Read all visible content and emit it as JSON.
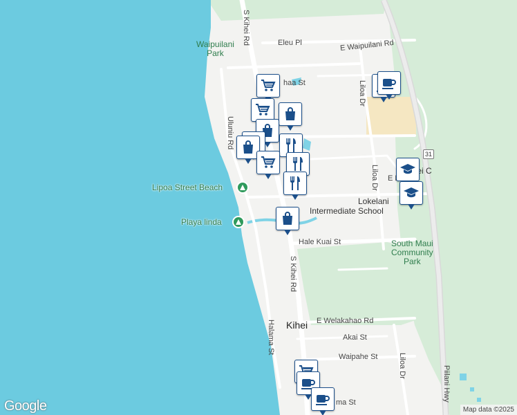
{
  "colors": {
    "ocean": "#6ccbe0",
    "land": "#f3f3f1",
    "park": "#d6ecd8",
    "commercial": "#f5e7c2",
    "road": "#ffffff",
    "highway": "#e3e3e3",
    "marker_border": "#1b4f8a"
  },
  "parks": {
    "waipuilani": "Waipuilani\nPark",
    "south_maui": "South Maui\nCommunity\nPark",
    "kihei_c": "Kihei C"
  },
  "streets": {
    "s_kihei_rd_north": "S Kihei Rd",
    "s_kihei_rd_south": "S Kihei Rd",
    "eleu_pl": "Eleu Pl",
    "e_waipuilani_rd": "E Waipuilani Rd",
    "haha_st": "haa St",
    "uluniu_rd": "Uluniu Rd",
    "liloa_dr_north": "Liloa Dr",
    "liloa_dr_mid": "Liloa Dr",
    "liloa_dr_south": "Liloa Dr",
    "e_li": "E Li",
    "hale_kuai_st": "Hale Kuai St",
    "e_welakahao_rd": "E Welakahao Rd",
    "akai_st": "Akai St",
    "waipahe_st": "Waipahe St",
    "halama_st": "Halama St",
    "piilani_hwy": "Piilani Hwy",
    "ma_st": "ma St"
  },
  "highway_shield": "31",
  "places": {
    "lipoa_beach": "Lipoa Street Beach",
    "playa_linda": "Playa linda",
    "lokelani": "Lokelani",
    "intermediate": "Intermediate School",
    "kihei": "Kihei"
  },
  "markers": [
    {
      "name": "grocery-marker",
      "icon": "cart"
    },
    {
      "name": "cafe-marker",
      "icon": "coffee"
    },
    {
      "name": "cafe-marker",
      "icon": "coffee"
    },
    {
      "name": "grocery-marker",
      "icon": "cart"
    },
    {
      "name": "shopping-marker",
      "icon": "bag"
    },
    {
      "name": "shopping-marker",
      "icon": "bag"
    },
    {
      "name": "restaurant-marker",
      "icon": "fork-knife"
    },
    {
      "name": "restaurant-marker",
      "icon": "fork-knife"
    },
    {
      "name": "shopping-marker",
      "icon": "bag"
    },
    {
      "name": "grocery-marker",
      "icon": "cart"
    },
    {
      "name": "restaurant-marker",
      "icon": "fork-knife"
    },
    {
      "name": "restaurant-marker",
      "icon": "fork-knife"
    },
    {
      "name": "school-marker",
      "icon": "school"
    },
    {
      "name": "school-marker",
      "icon": "school"
    },
    {
      "name": "shopping-marker",
      "icon": "bag"
    },
    {
      "name": "grocery-marker",
      "icon": "cart"
    },
    {
      "name": "cafe-marker",
      "icon": "coffee"
    },
    {
      "name": "cafe-marker",
      "icon": "coffee"
    }
  ],
  "branding": {
    "logo": "Google",
    "attribution": "Map data ©2025"
  }
}
